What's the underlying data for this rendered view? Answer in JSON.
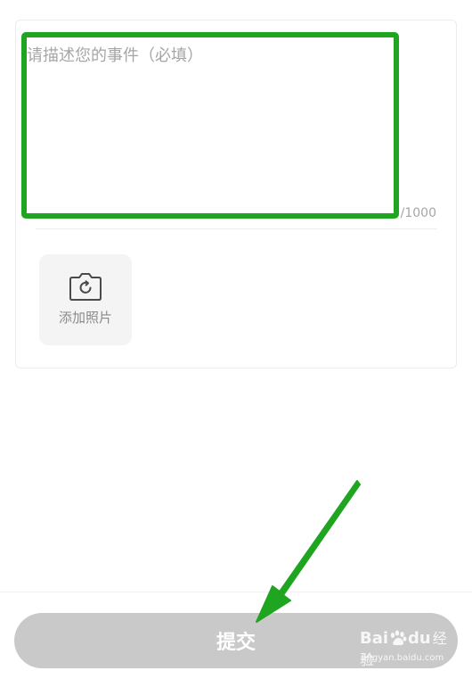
{
  "form": {
    "description_placeholder": "请描述您的事件（必填）",
    "description_value": "",
    "char_counter": "/1000",
    "add_photo_label": "添加照片",
    "add_photo_icon": "camera-icon"
  },
  "footer": {
    "submit_label": "提交"
  },
  "annotations": {
    "highlight_color": "#1fa51f",
    "arrow_color": "#1fa51f"
  },
  "watermark": {
    "logo_text_bai": "Bai",
    "logo_text_du": "du",
    "product": "经验",
    "url": "jingyan.baidu.com"
  },
  "colors": {
    "submit_bg": "#c9c9c9",
    "placeholder": "#a6a6a6",
    "photo_tile_bg": "#f4f4f4"
  }
}
